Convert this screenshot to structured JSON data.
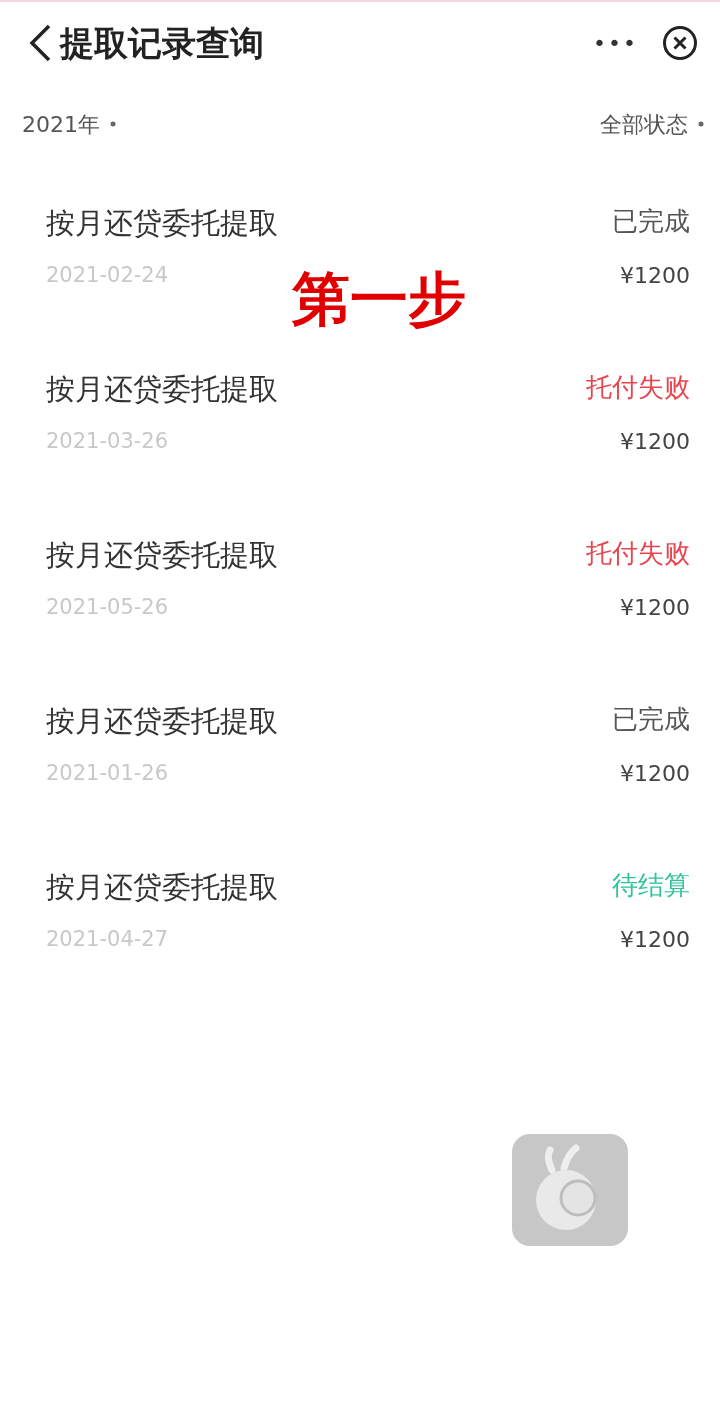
{
  "header": {
    "title": "提取记录查询",
    "more": "•••"
  },
  "filters": {
    "year": "2021年",
    "status": "全部状态"
  },
  "annotation": "第一步",
  "records": [
    {
      "title": "按月还贷委托提取",
      "date": "2021-02-24",
      "status": "已完成",
      "kind": "done",
      "amount": "¥1200"
    },
    {
      "title": "按月还贷委托提取",
      "date": "2021-03-26",
      "status": "托付失败",
      "kind": "failed",
      "amount": "¥1200"
    },
    {
      "title": "按月还贷委托提取",
      "date": "2021-05-26",
      "status": "托付失败",
      "kind": "failed",
      "amount": "¥1200"
    },
    {
      "title": "按月还贷委托提取",
      "date": "2021-01-26",
      "status": "已完成",
      "kind": "done",
      "amount": "¥1200"
    },
    {
      "title": "按月还贷委托提取",
      "date": "2021-04-27",
      "status": "待结算",
      "kind": "pending",
      "amount": "¥1200"
    }
  ]
}
